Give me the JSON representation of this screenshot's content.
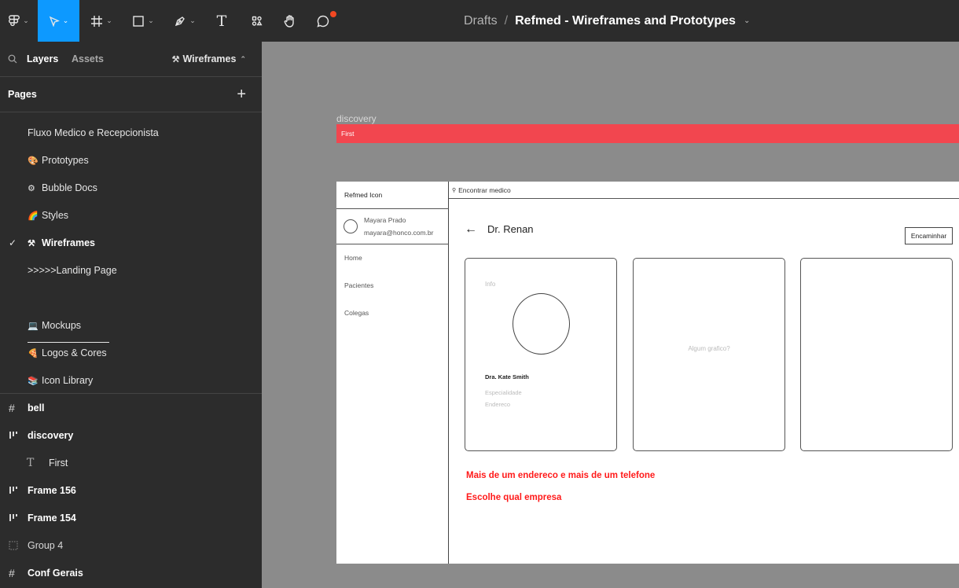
{
  "toolbar": {
    "text_tool_glyph": "T",
    "title": {
      "location": "Drafts",
      "separator": "/",
      "project": "Refmed - Wireframes and Prototypes"
    }
  },
  "sidebar": {
    "tabs": {
      "layers": "Layers",
      "assets": "Assets"
    },
    "current_page": "Wireframes",
    "pages_header": "Pages",
    "add_glyph": "+",
    "pages": [
      {
        "label": "Fluxo Medico e Recepcionista",
        "emoji": ""
      },
      {
        "label": "Prototypes",
        "emoji": "🎨"
      },
      {
        "label": "Bubble Docs",
        "emoji": "⚙"
      },
      {
        "label": "Styles",
        "emoji": "🌈"
      },
      {
        "label": "Wireframes",
        "emoji": "⚒",
        "selected": true
      },
      {
        "label": ">>>>>Landing Page",
        "emoji": ""
      },
      {
        "label": "Mockups",
        "emoji": "💻"
      },
      {
        "label": "Logos & Cores",
        "emoji": "🍕"
      },
      {
        "label": "Icon Library",
        "emoji": "📚"
      }
    ],
    "layers": [
      {
        "label": "bell",
        "icon": "frame-icon"
      },
      {
        "label": "discovery",
        "icon": "autolayout-icon"
      },
      {
        "label": "First",
        "icon": "text-icon"
      },
      {
        "label": "Frame 156",
        "icon": "autolayout-icon"
      },
      {
        "label": "Frame 154",
        "icon": "autolayout-icon"
      },
      {
        "label": "Group 4",
        "icon": "group-icon"
      },
      {
        "label": "Conf Gerais",
        "icon": "frame-icon"
      }
    ]
  },
  "canvas": {
    "frame_label": "discovery",
    "bar_text": "First",
    "wireframe": {
      "brand": "Refmed Icon",
      "user_name": "Mayara Prado",
      "user_email": "mayara@honco.com.br",
      "nav": [
        "Home",
        "Pacientes",
        "Colegas"
      ],
      "search_placeholder": "Encontrar medico",
      "back_arrow": "←",
      "doctor_title": "Dr. Renan",
      "button": "Encaminhar",
      "card1": {
        "info": "Info",
        "name": "Dra. Kate Smith",
        "specialty": "Especialidade",
        "address": "Endereco"
      },
      "card2_text": "Algum grafico?",
      "notes": [
        "Mais de um endereco e mais de um telefone",
        "Escolhe qual empresa"
      ]
    }
  },
  "colors": {
    "toolbar_bg": "#2c2c2c",
    "active_tool": "#0d99ff",
    "canvas_bg": "#8b8b8b",
    "bar": "#f2464f",
    "note_red": "#ff1a1a"
  }
}
